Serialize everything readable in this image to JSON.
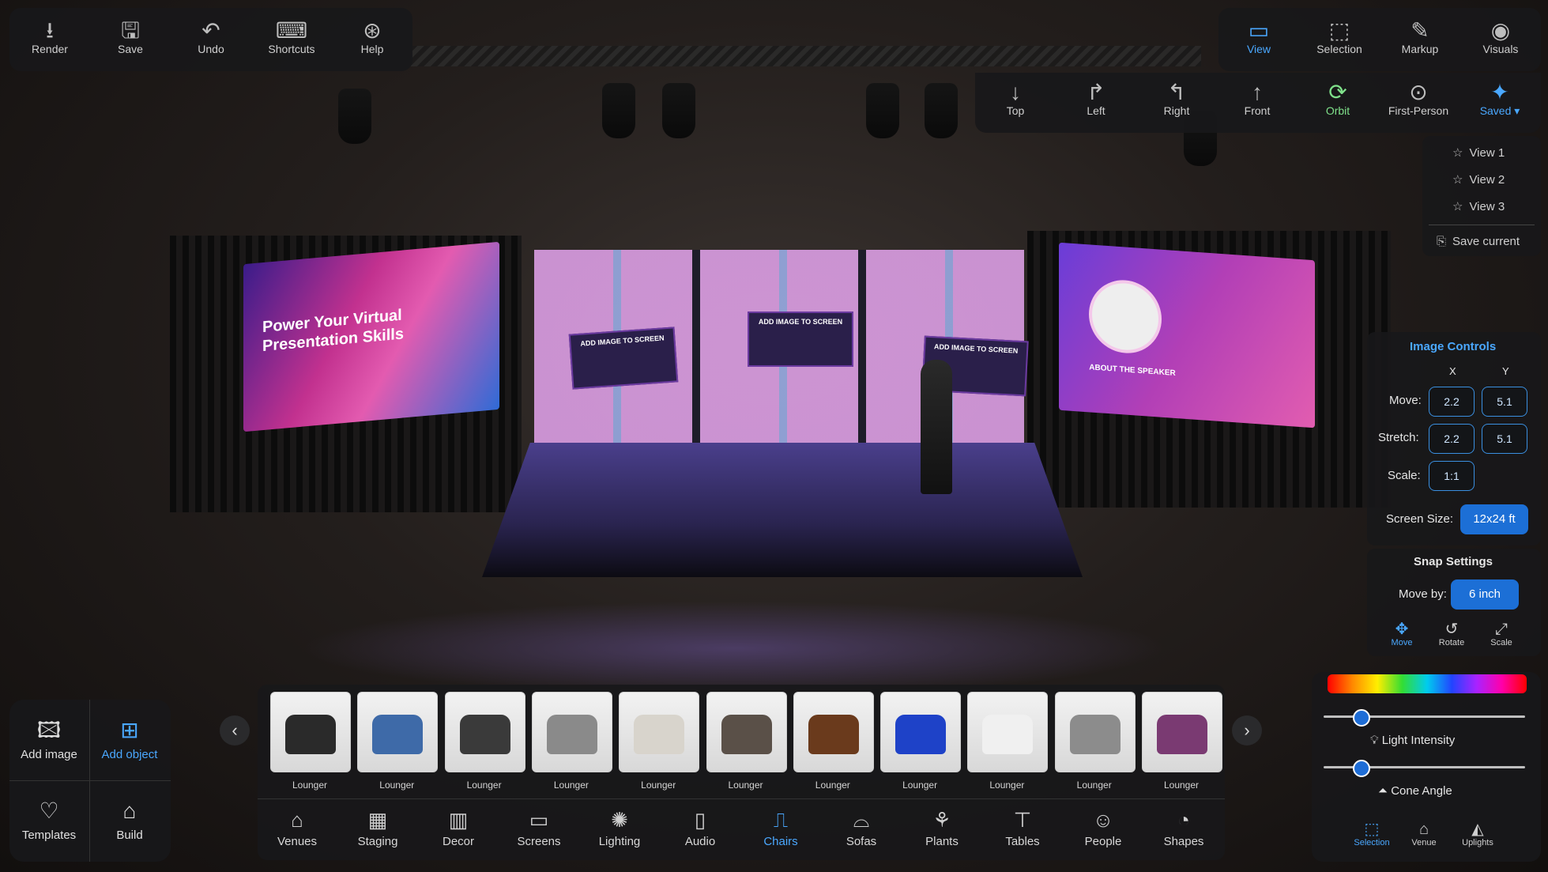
{
  "toolbar_left": [
    {
      "label": "Render",
      "icon": "download-icon"
    },
    {
      "label": "Save",
      "icon": "floppy-icon"
    },
    {
      "label": "Undo",
      "icon": "undo-icon"
    },
    {
      "label": "Shortcuts",
      "icon": "keyboard-icon"
    },
    {
      "label": "Help",
      "icon": "lifebuoy-icon"
    }
  ],
  "toolbar_right": [
    {
      "label": "View",
      "icon": "video-camera-icon",
      "active": true
    },
    {
      "label": "Selection",
      "icon": "selection-icon"
    },
    {
      "label": "Markup",
      "icon": "markup-icon"
    },
    {
      "label": "Visuals",
      "icon": "eye-icon"
    }
  ],
  "view_bar": [
    {
      "label": "Top",
      "icon": "arrow-down-icon"
    },
    {
      "label": "Left",
      "icon": "arrow-turn-right-icon"
    },
    {
      "label": "Right",
      "icon": "arrow-turn-left-icon"
    },
    {
      "label": "Front",
      "icon": "arrow-up-icon"
    },
    {
      "label": "Orbit",
      "icon": "orbit-icon",
      "state": "green"
    },
    {
      "label": "First-Person",
      "icon": "first-person-icon"
    },
    {
      "label": "Saved",
      "icon": "saved-view-icon",
      "active": true
    }
  ],
  "saved_views": [
    "View 1",
    "View 2",
    "View 3"
  ],
  "save_current": "Save current",
  "stage_screens": {
    "left_title": "Power Your Virtual Presentation Skills",
    "right_caption": "ABOUT THE SPEAKER",
    "panel_caption": "ADD IMAGE TO SCREEN"
  },
  "image_controls": {
    "title": "Image Controls",
    "col_x": "X",
    "col_y": "Y",
    "move_label": "Move:",
    "move_x": "2.2",
    "move_y": "5.1",
    "stretch_label": "Stretch:",
    "stretch_x": "2.2",
    "stretch_y": "5.1",
    "scale_label": "Scale:",
    "scale": "1:1",
    "screen_size_label": "Screen Size:",
    "screen_size": "12x24 ft"
  },
  "snap_settings": {
    "title": "Snap Settings",
    "move_by_label": "Move by:",
    "move_by": "6 inch",
    "modes": [
      {
        "label": "Move",
        "icon": "move-icon",
        "active": true
      },
      {
        "label": "Rotate",
        "icon": "rotate-icon"
      },
      {
        "label": "Scale",
        "icon": "scale-icon"
      }
    ]
  },
  "lighting": {
    "light_intensity_label": "Light Intensity",
    "cone_angle_label": "Cone Angle",
    "light_intensity_value": 0.18,
    "cone_angle_value": 0.18,
    "tabs": [
      {
        "label": "Selection",
        "icon": "selection-icon",
        "active": true
      },
      {
        "label": "Venue",
        "icon": "venue-icon"
      },
      {
        "label": "Uplights",
        "icon": "uplights-icon"
      }
    ]
  },
  "left_actions": [
    {
      "label": "Add image",
      "icon": "add-image-icon"
    },
    {
      "label": "Add object",
      "icon": "add-object-icon",
      "active": true
    },
    {
      "label": "Templates",
      "icon": "heart-plus-icon"
    },
    {
      "label": "Build",
      "icon": "build-icon"
    }
  ],
  "items": [
    {
      "label": "Lounger",
      "color": "#2a2a2a"
    },
    {
      "label": "Lounger",
      "color": "#3e6aa8"
    },
    {
      "label": "Lounger",
      "color": "#3a3a3a"
    },
    {
      "label": "Lounger",
      "color": "#8a8a8a"
    },
    {
      "label": "Lounger",
      "color": "#d8d4cc"
    },
    {
      "label": "Lounger",
      "color": "#5a5048"
    },
    {
      "label": "Lounger",
      "color": "#6a3a1c"
    },
    {
      "label": "Lounger",
      "color": "#1e42c8"
    },
    {
      "label": "Lounger",
      "color": "#f0f0f0"
    },
    {
      "label": "Lounger",
      "color": "#8c8c8c"
    },
    {
      "label": "Lounger",
      "color": "#7a3a72"
    }
  ],
  "categories": [
    {
      "label": "Venues",
      "icon": "venue-icon"
    },
    {
      "label": "Staging",
      "icon": "staging-icon"
    },
    {
      "label": "Decor",
      "icon": "decor-icon"
    },
    {
      "label": "Screens",
      "icon": "monitor-icon"
    },
    {
      "label": "Lighting",
      "icon": "lighting-icon"
    },
    {
      "label": "Audio",
      "icon": "speaker-icon"
    },
    {
      "label": "Chairs",
      "icon": "chair-icon",
      "active": true
    },
    {
      "label": "Sofas",
      "icon": "sofa-icon"
    },
    {
      "label": "Plants",
      "icon": "plant-icon"
    },
    {
      "label": "Tables",
      "icon": "table-icon"
    },
    {
      "label": "People",
      "icon": "people-icon"
    },
    {
      "label": "Shapes",
      "icon": "shapes-icon"
    }
  ]
}
